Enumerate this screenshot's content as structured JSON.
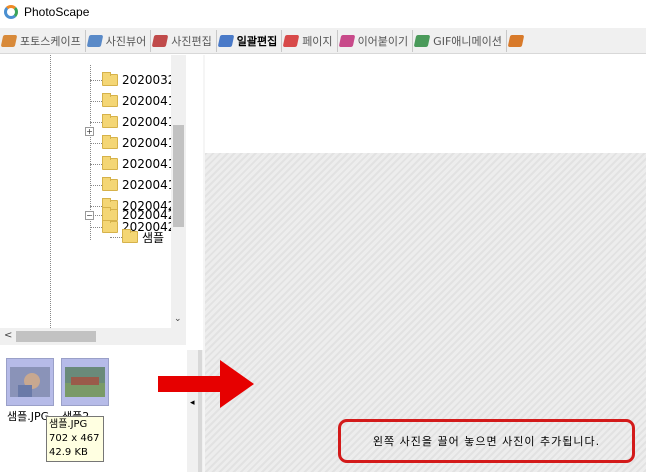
{
  "window": {
    "title": "PhotoScape"
  },
  "tabs": [
    {
      "label": "포토스케이프",
      "color": "#d88a3a"
    },
    {
      "label": "사진뷰어",
      "color": "#5a8ac8"
    },
    {
      "label": "사진편집",
      "color": "#c04a4a"
    },
    {
      "label": "일괄편집",
      "color": "#4a7ac8",
      "active": true
    },
    {
      "label": "페이지",
      "color": "#d84a4a"
    },
    {
      "label": "이어붙이기",
      "color": "#c84a8a"
    },
    {
      "label": "GIF애니메이션",
      "color": "#4a9a5a"
    },
    {
      "label": "",
      "color": "#d87a2a"
    }
  ],
  "tree": {
    "items": [
      {
        "label": "2020032"
      },
      {
        "label": "2020041"
      },
      {
        "label": "2020041"
      },
      {
        "label": "2020041",
        "expandable": true
      },
      {
        "label": "2020041"
      },
      {
        "label": "2020041"
      },
      {
        "label": "2020042"
      },
      {
        "label": "2020042"
      },
      {
        "label": "2020042",
        "expanded": true
      },
      {
        "label": "샘플",
        "child": true
      }
    ],
    "collapse_glyph": "−",
    "expand_glyph": "+"
  },
  "scroll": {
    "down_arrow": "⌄",
    "left_arrow": "<"
  },
  "thumbnails": [
    {
      "label": "샘플.JPG"
    },
    {
      "label": "샘플2...."
    }
  ],
  "tooltip": {
    "filename": "샘플.JPG",
    "dimensions": "702 x 467",
    "size": "42.9 KB"
  },
  "splitter": {
    "arrow": "◂"
  },
  "drop_area": {
    "message": "왼쪽 사진을 끌어 놓으면 사진이 추가됩니다."
  },
  "colors": {
    "arrow": "#e60000",
    "highlight_box": "#d31a1a"
  }
}
